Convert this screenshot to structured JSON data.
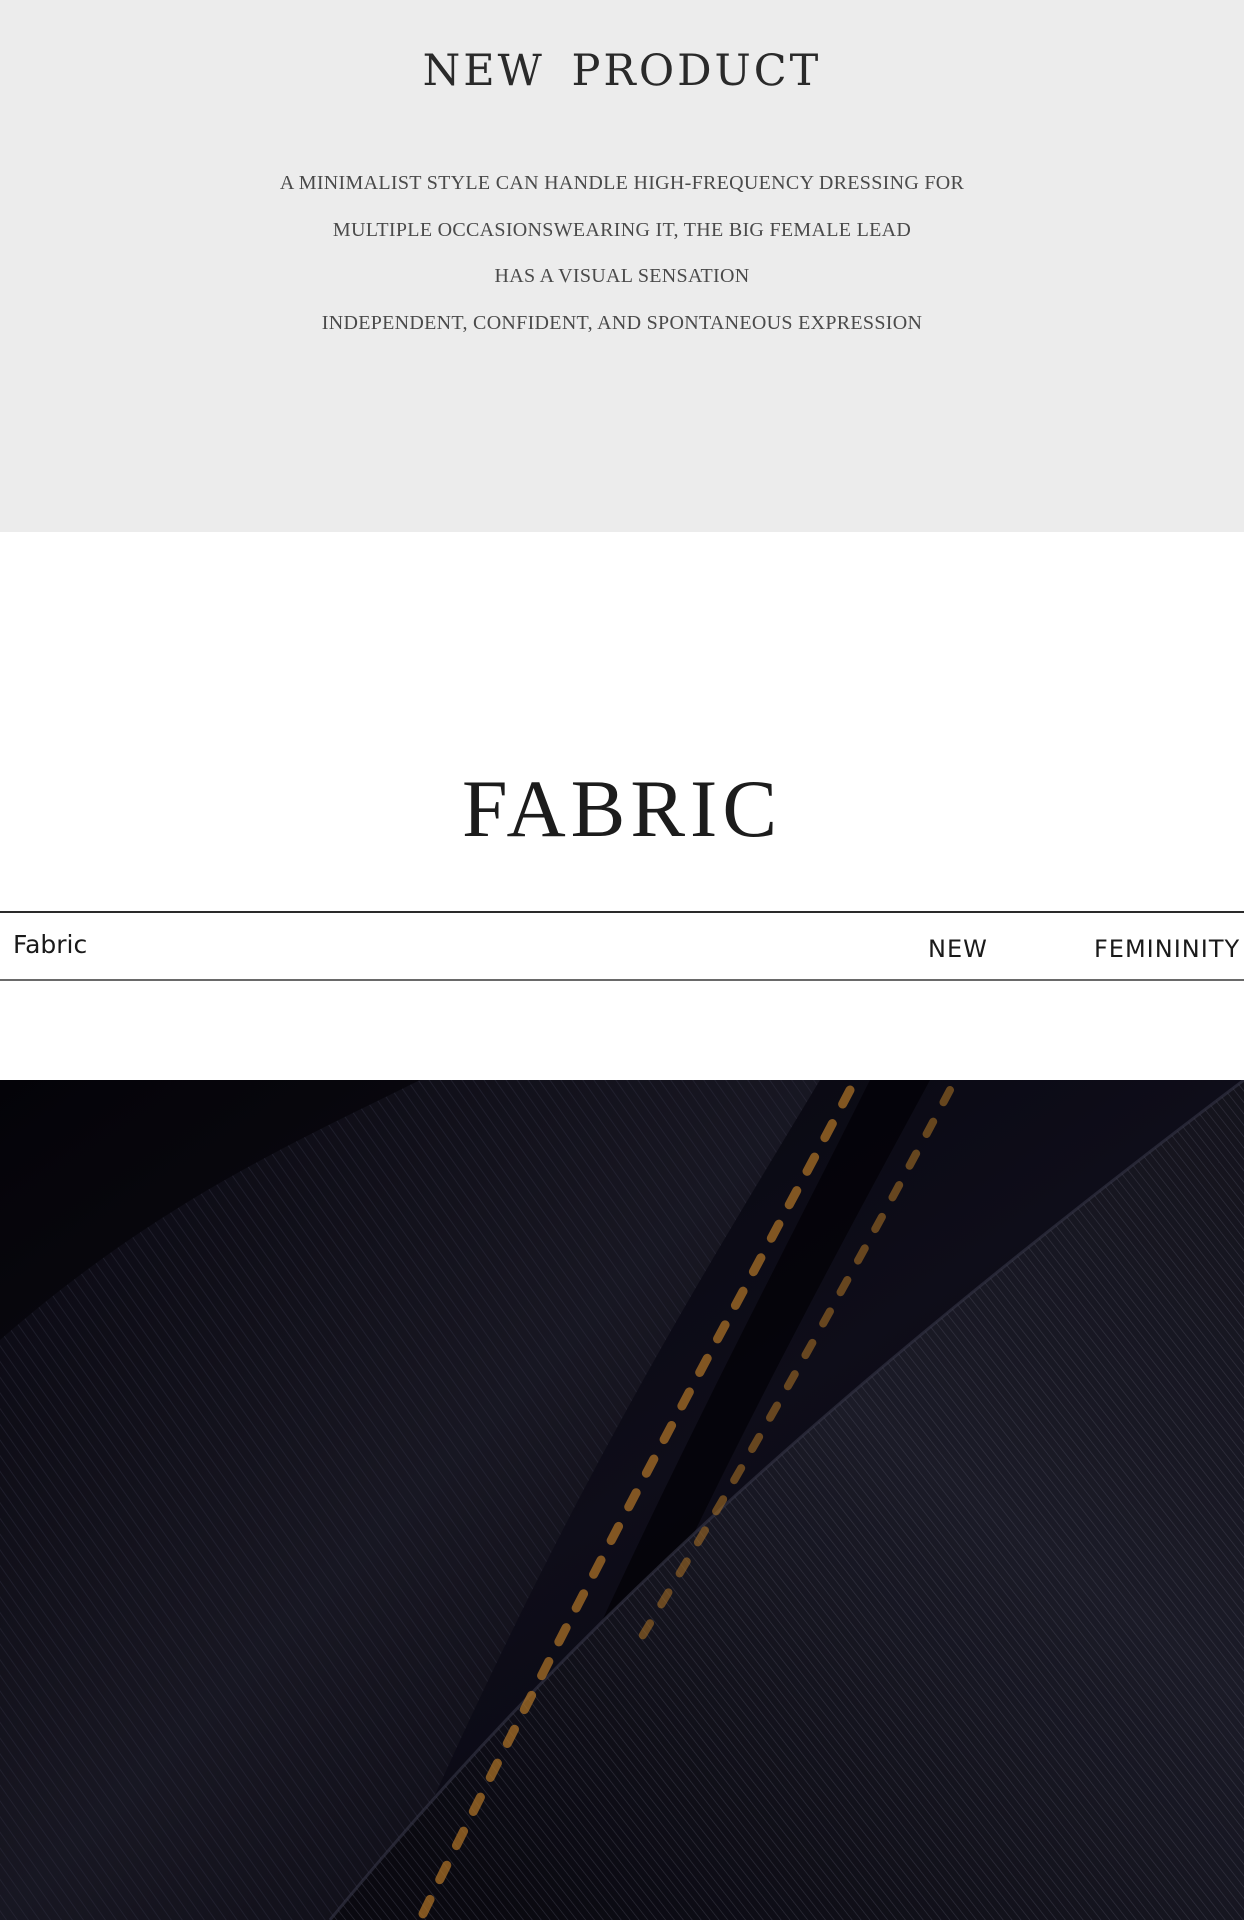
{
  "intro": {
    "title": "NEW  PRODUCT",
    "lines": [
      "A MINIMALIST STYLE CAN HANDLE HIGH-FREQUENCY DRESSING FOR",
      "MULTIPLE OCCASIONSWEARING IT, THE BIG FEMALE LEAD",
      "HAS A VISUAL SENSATION",
      "INDEPENDENT, CONFIDENT, AND SPONTANEOUS EXPRESSION"
    ]
  },
  "fabric": {
    "title": "FABRIC",
    "strip": {
      "left_label": "Fabric",
      "right_labels": [
        "NEW",
        "FEMININITY"
      ]
    }
  },
  "colors": {
    "intro_bg": "#ececec",
    "denim_dark": "#07060d",
    "denim_mid": "#1a1a28",
    "stitch": "#b87a2a"
  }
}
